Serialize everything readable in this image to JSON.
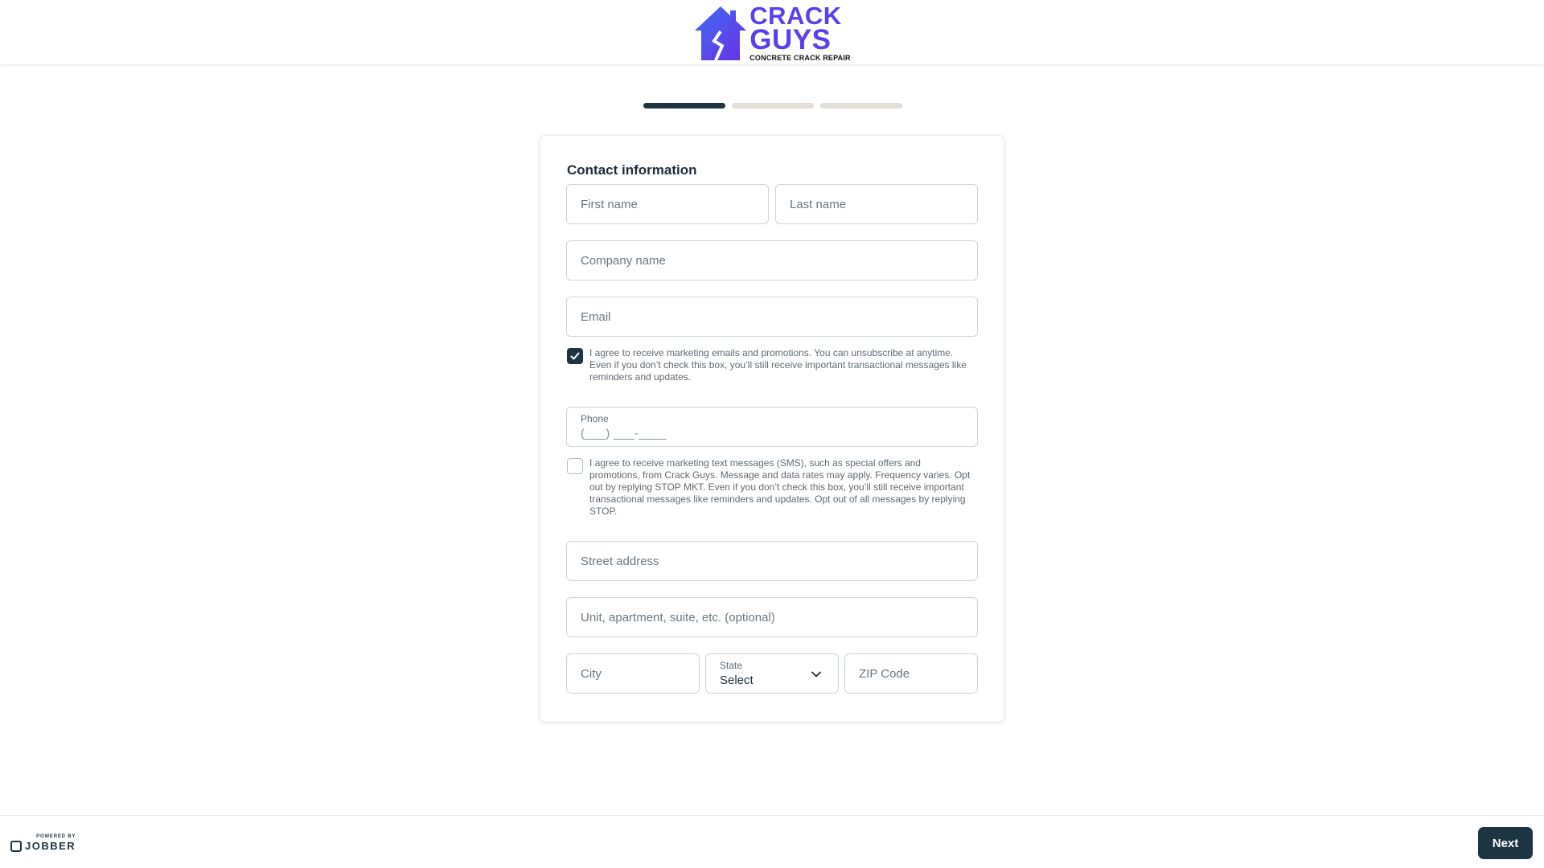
{
  "brand": {
    "line1": "CRACK",
    "line2": "GUYS",
    "tagline": "CONCRETE CRACK REPAIR",
    "color": "#5a3ff0"
  },
  "progress": {
    "total_steps": 3,
    "current_step": 1
  },
  "form": {
    "title": "Contact information",
    "first_name": {
      "placeholder": "First name",
      "value": ""
    },
    "last_name": {
      "placeholder": "Last name",
      "value": ""
    },
    "company": {
      "placeholder": "Company name",
      "value": ""
    },
    "email": {
      "placeholder": "Email",
      "value": ""
    },
    "email_consent": {
      "checked": true,
      "text": "I agree to receive marketing emails and promotions. You can unsubscribe at anytime. Even if you don’t check this box, you’ll still receive important transactional messages like reminders and updates."
    },
    "phone": {
      "label": "Phone",
      "mask": "(___) ___-____"
    },
    "sms_consent": {
      "checked": false,
      "text": "I agree to receive marketing text messages (SMS), such as special offers and promotions, from Crack Guys. Message and data rates may apply. Frequency varies. Opt out by replying STOP MKT. Even if you don’t check this box, you’ll still receive important transactional messages like reminders and updates. Opt out of all messages by replying STOP."
    },
    "street": {
      "placeholder": "Street address",
      "value": ""
    },
    "unit": {
      "placeholder": "Unit, apartment, suite, etc. (optional)",
      "value": ""
    },
    "city": {
      "placeholder": "City",
      "value": ""
    },
    "state": {
      "label": "State",
      "value": "Select"
    },
    "zip": {
      "placeholder": "ZIP Code",
      "value": ""
    }
  },
  "footer": {
    "powered_by": "POWERED BY",
    "vendor": "JOBBER",
    "next_label": "Next",
    "accent": "#1d3442"
  }
}
